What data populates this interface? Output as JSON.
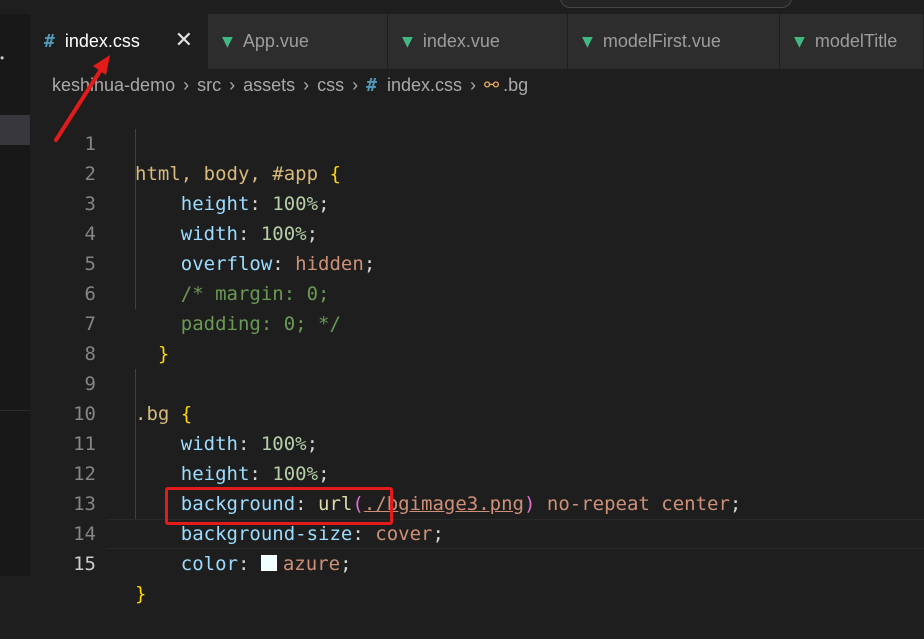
{
  "tabs": [
    {
      "label": "index.css",
      "type": "css",
      "active": true
    },
    {
      "label": "App.vue",
      "type": "vue",
      "active": false
    },
    {
      "label": "index.vue",
      "type": "vue",
      "active": false
    },
    {
      "label": "modelFirst.vue",
      "type": "vue",
      "active": false
    },
    {
      "label": "modelTitle",
      "type": "vue",
      "active": false
    }
  ],
  "breadcrumb": {
    "parts": [
      "keshihua-demo",
      "src",
      "assets",
      "css"
    ],
    "file": "index.css",
    "symbol": ".bg"
  },
  "editor": {
    "current_line": 15,
    "line_numbers": [
      "1",
      "2",
      "3",
      "4",
      "5",
      "6",
      "7",
      "8",
      "9",
      "10",
      "11",
      "12",
      "13",
      "14",
      "15"
    ],
    "lines": {
      "l1": {
        "sel": "html, body, #app",
        "brace": "{"
      },
      "l2": {
        "prop": "height",
        "val": "100%"
      },
      "l3": {
        "prop": "width",
        "val": "100%"
      },
      "l4": {
        "prop": "overflow",
        "val": "hidden"
      },
      "l5": {
        "comment": "/* margin: 0;"
      },
      "l6": {
        "comment": "padding: 0; */"
      },
      "l7": {
        "brace": "}"
      },
      "l9": {
        "sel": ".bg",
        "brace": "{"
      },
      "l10": {
        "prop": "width",
        "val": "100%"
      },
      "l11": {
        "prop": "height",
        "val": "100%"
      },
      "l12": {
        "prop": "background",
        "fn": "url",
        "arg": "./bgimage3.png",
        "rest": "no-repeat center"
      },
      "l13": {
        "prop": "background-size",
        "val": "cover"
      },
      "l14": {
        "prop": "color",
        "val": "azure"
      },
      "l15": {
        "brace": "}"
      }
    }
  },
  "colors": {
    "annotation": "#e31b1b",
    "azure_swatch": "#f0ffff"
  }
}
